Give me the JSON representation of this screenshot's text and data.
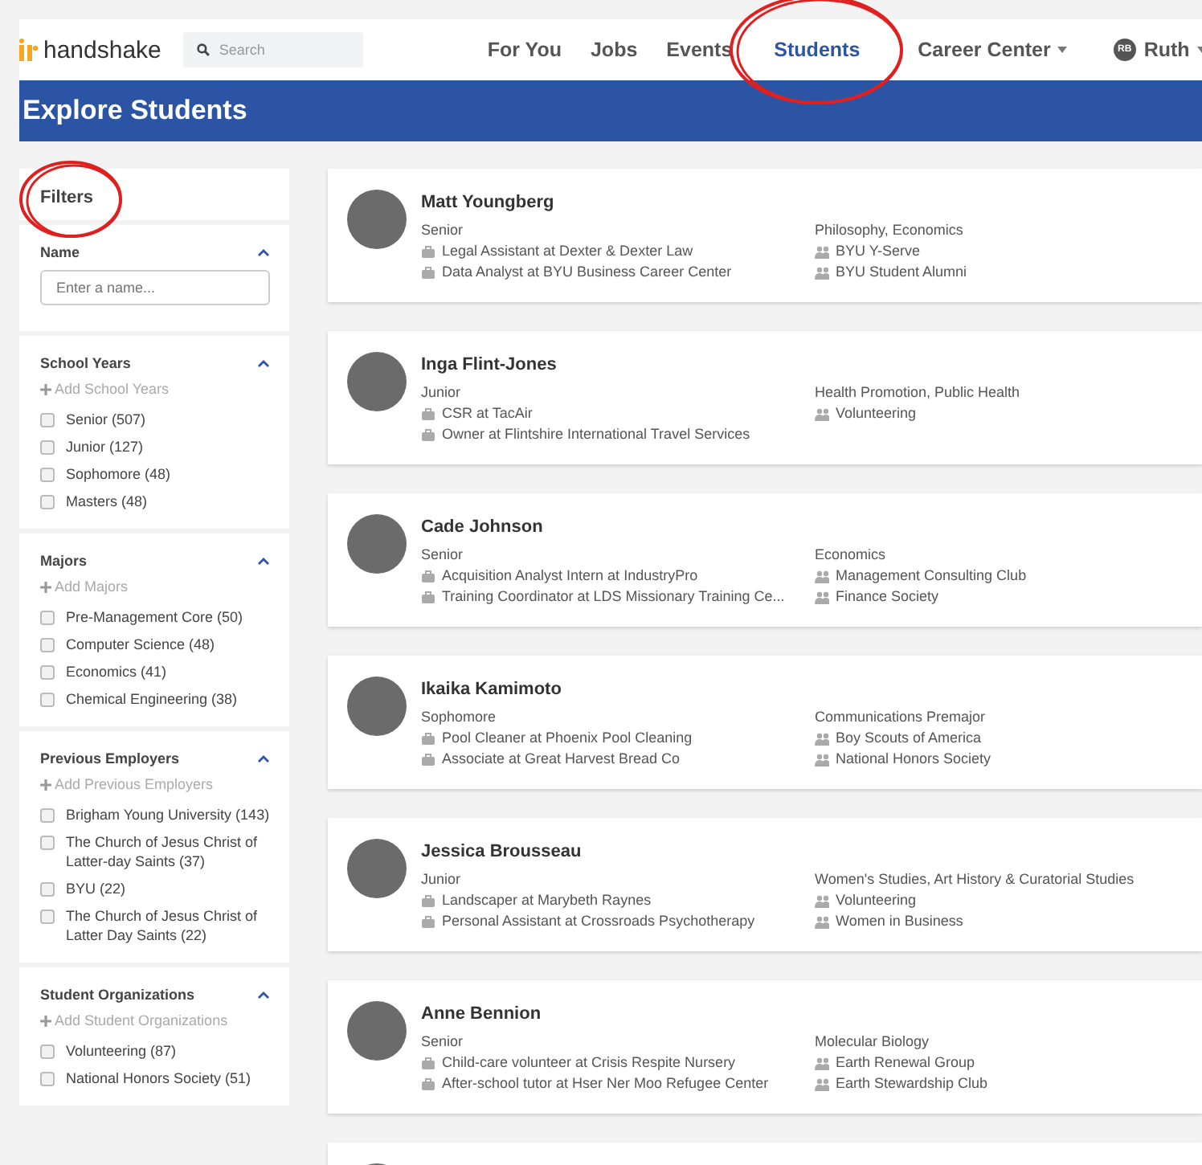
{
  "header": {
    "logo": "handshake",
    "search": {
      "placeholder": "Search"
    },
    "nav": [
      {
        "label": "For You",
        "selected": false,
        "dropdown": false,
        "circled": false
      },
      {
        "label": "Jobs",
        "selected": false,
        "dropdown": false,
        "circled": false
      },
      {
        "label": "Events",
        "selected": false,
        "dropdown": false,
        "circled": false
      },
      {
        "label": "Students",
        "selected": true,
        "dropdown": false,
        "circled": true
      },
      {
        "label": "Career Center",
        "selected": false,
        "dropdown": true,
        "circled": false
      }
    ],
    "user": {
      "initials": "RB",
      "name": "Ruth",
      "dropdown": true
    }
  },
  "page_title": "Explore Students",
  "filters": {
    "title": "Filters",
    "circled": true,
    "sections": [
      {
        "kind": "text",
        "title": "Name",
        "expanded": true,
        "placeholder": "Enter a name..."
      },
      {
        "kind": "checklist",
        "title": "School Years",
        "expanded": true,
        "add": "Add School Years",
        "options": [
          {
            "label": "Senior (507)",
            "checked": false
          },
          {
            "label": "Junior (127)",
            "checked": false
          },
          {
            "label": "Sophomore (48)",
            "checked": false
          },
          {
            "label": "Masters (48)",
            "checked": false
          }
        ]
      },
      {
        "kind": "checklist",
        "title": "Majors",
        "expanded": true,
        "add": "Add Majors",
        "options": [
          {
            "label": "Pre-Management Core (50)",
            "checked": false
          },
          {
            "label": "Computer Science (48)",
            "checked": false
          },
          {
            "label": "Economics (41)",
            "checked": false
          },
          {
            "label": "Chemical Engineering (38)",
            "checked": false
          }
        ]
      },
      {
        "kind": "checklist",
        "title": "Previous Employers",
        "expanded": true,
        "add": "Add Previous Employers",
        "options": [
          {
            "label": "Brigham Young University (143)",
            "checked": false
          },
          {
            "label": "The Church of Jesus Christ of Latter-day Saints (37)",
            "checked": false
          },
          {
            "label": "BYU (22)",
            "checked": false
          },
          {
            "label": "The Church of Jesus Christ of Latter Day Saints (22)",
            "checked": false
          }
        ]
      },
      {
        "kind": "checklist",
        "title": "Student Organizations",
        "expanded": true,
        "add": "Add Student Organizations",
        "options": [
          {
            "label": "Volunteering (87)",
            "checked": false
          },
          {
            "label": "National Honors Society (51)",
            "checked": false
          }
        ]
      }
    ]
  },
  "students": [
    {
      "name": "Matt Youngberg",
      "year": "Senior",
      "jobs": [
        "Legal Assistant at Dexter & Dexter Law",
        "Data Analyst at BYU Business Career Center"
      ],
      "majors": "Philosophy, Economics",
      "organizations": [
        "BYU Y-Serve",
        "BYU Student Alumni"
      ]
    },
    {
      "name": "Inga Flint-Jones",
      "year": "Junior",
      "jobs": [
        "CSR at TacAir",
        "Owner at Flintshire International Travel Services"
      ],
      "majors": "Health Promotion, Public Health",
      "organizations": [
        "Volunteering"
      ]
    },
    {
      "name": "Cade Johnson",
      "year": "Senior",
      "jobs": [
        "Acquisition Analyst Intern at IndustryPro",
        "Training Coordinator at LDS Missionary Training Ce..."
      ],
      "majors": "Economics",
      "organizations": [
        "Management Consulting Club",
        "Finance Society"
      ]
    },
    {
      "name": "Ikaika Kamimoto",
      "year": "Sophomore",
      "jobs": [
        "Pool Cleaner at Phoenix Pool Cleaning",
        "Associate at Great Harvest Bread Co"
      ],
      "majors": "Communications Premajor",
      "organizations": [
        "Boy Scouts of America",
        "National Honors Society"
      ]
    },
    {
      "name": "Jessica Brousseau",
      "year": "Junior",
      "jobs": [
        "Landscaper at Marybeth Raynes",
        "Personal Assistant at Crossroads Psychotherapy"
      ],
      "majors": "Women's Studies, Art History & Curatorial Studies",
      "organizations": [
        "Volunteering",
        "Women in Business"
      ]
    },
    {
      "name": "Anne Bennion",
      "year": "Senior",
      "jobs": [
        "Child-care volunteer at Crisis Respite Nursery",
        "After-school tutor at Hser Ner Moo Refugee Center"
      ],
      "majors": "Molecular Biology",
      "organizations": [
        "Earth Renewal Group",
        "Earth Stewardship Club"
      ]
    }
  ]
}
